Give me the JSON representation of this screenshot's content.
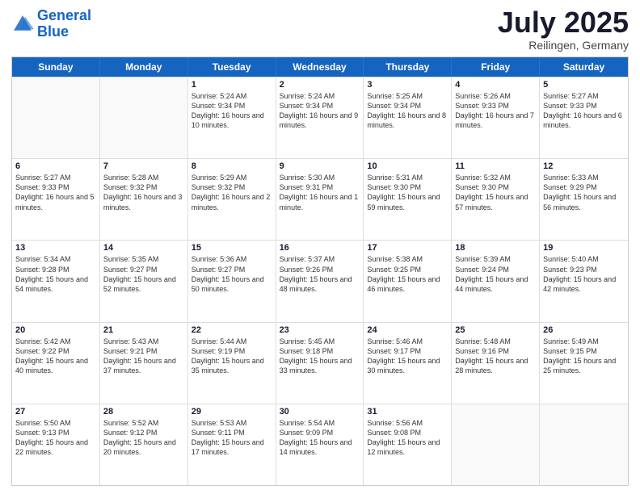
{
  "logo": {
    "line1": "General",
    "line2": "Blue"
  },
  "title": "July 2025",
  "location": "Reilingen, Germany",
  "weekdays": [
    "Sunday",
    "Monday",
    "Tuesday",
    "Wednesday",
    "Thursday",
    "Friday",
    "Saturday"
  ],
  "rows": [
    [
      {
        "day": "",
        "sunrise": "",
        "sunset": "",
        "daylight": ""
      },
      {
        "day": "",
        "sunrise": "",
        "sunset": "",
        "daylight": ""
      },
      {
        "day": "1",
        "sunrise": "Sunrise: 5:24 AM",
        "sunset": "Sunset: 9:34 PM",
        "daylight": "Daylight: 16 hours and 10 minutes."
      },
      {
        "day": "2",
        "sunrise": "Sunrise: 5:24 AM",
        "sunset": "Sunset: 9:34 PM",
        "daylight": "Daylight: 16 hours and 9 minutes."
      },
      {
        "day": "3",
        "sunrise": "Sunrise: 5:25 AM",
        "sunset": "Sunset: 9:34 PM",
        "daylight": "Daylight: 16 hours and 8 minutes."
      },
      {
        "day": "4",
        "sunrise": "Sunrise: 5:26 AM",
        "sunset": "Sunset: 9:33 PM",
        "daylight": "Daylight: 16 hours and 7 minutes."
      },
      {
        "day": "5",
        "sunrise": "Sunrise: 5:27 AM",
        "sunset": "Sunset: 9:33 PM",
        "daylight": "Daylight: 16 hours and 6 minutes."
      }
    ],
    [
      {
        "day": "6",
        "sunrise": "Sunrise: 5:27 AM",
        "sunset": "Sunset: 9:33 PM",
        "daylight": "Daylight: 16 hours and 5 minutes."
      },
      {
        "day": "7",
        "sunrise": "Sunrise: 5:28 AM",
        "sunset": "Sunset: 9:32 PM",
        "daylight": "Daylight: 16 hours and 3 minutes."
      },
      {
        "day": "8",
        "sunrise": "Sunrise: 5:29 AM",
        "sunset": "Sunset: 9:32 PM",
        "daylight": "Daylight: 16 hours and 2 minutes."
      },
      {
        "day": "9",
        "sunrise": "Sunrise: 5:30 AM",
        "sunset": "Sunset: 9:31 PM",
        "daylight": "Daylight: 16 hours and 1 minute."
      },
      {
        "day": "10",
        "sunrise": "Sunrise: 5:31 AM",
        "sunset": "Sunset: 9:30 PM",
        "daylight": "Daylight: 15 hours and 59 minutes."
      },
      {
        "day": "11",
        "sunrise": "Sunrise: 5:32 AM",
        "sunset": "Sunset: 9:30 PM",
        "daylight": "Daylight: 15 hours and 57 minutes."
      },
      {
        "day": "12",
        "sunrise": "Sunrise: 5:33 AM",
        "sunset": "Sunset: 9:29 PM",
        "daylight": "Daylight: 15 hours and 56 minutes."
      }
    ],
    [
      {
        "day": "13",
        "sunrise": "Sunrise: 5:34 AM",
        "sunset": "Sunset: 9:28 PM",
        "daylight": "Daylight: 15 hours and 54 minutes."
      },
      {
        "day": "14",
        "sunrise": "Sunrise: 5:35 AM",
        "sunset": "Sunset: 9:27 PM",
        "daylight": "Daylight: 15 hours and 52 minutes."
      },
      {
        "day": "15",
        "sunrise": "Sunrise: 5:36 AM",
        "sunset": "Sunset: 9:27 PM",
        "daylight": "Daylight: 15 hours and 50 minutes."
      },
      {
        "day": "16",
        "sunrise": "Sunrise: 5:37 AM",
        "sunset": "Sunset: 9:26 PM",
        "daylight": "Daylight: 15 hours and 48 minutes."
      },
      {
        "day": "17",
        "sunrise": "Sunrise: 5:38 AM",
        "sunset": "Sunset: 9:25 PM",
        "daylight": "Daylight: 15 hours and 46 minutes."
      },
      {
        "day": "18",
        "sunrise": "Sunrise: 5:39 AM",
        "sunset": "Sunset: 9:24 PM",
        "daylight": "Daylight: 15 hours and 44 minutes."
      },
      {
        "day": "19",
        "sunrise": "Sunrise: 5:40 AM",
        "sunset": "Sunset: 9:23 PM",
        "daylight": "Daylight: 15 hours and 42 minutes."
      }
    ],
    [
      {
        "day": "20",
        "sunrise": "Sunrise: 5:42 AM",
        "sunset": "Sunset: 9:22 PM",
        "daylight": "Daylight: 15 hours and 40 minutes."
      },
      {
        "day": "21",
        "sunrise": "Sunrise: 5:43 AM",
        "sunset": "Sunset: 9:21 PM",
        "daylight": "Daylight: 15 hours and 37 minutes."
      },
      {
        "day": "22",
        "sunrise": "Sunrise: 5:44 AM",
        "sunset": "Sunset: 9:19 PM",
        "daylight": "Daylight: 15 hours and 35 minutes."
      },
      {
        "day": "23",
        "sunrise": "Sunrise: 5:45 AM",
        "sunset": "Sunset: 9:18 PM",
        "daylight": "Daylight: 15 hours and 33 minutes."
      },
      {
        "day": "24",
        "sunrise": "Sunrise: 5:46 AM",
        "sunset": "Sunset: 9:17 PM",
        "daylight": "Daylight: 15 hours and 30 minutes."
      },
      {
        "day": "25",
        "sunrise": "Sunrise: 5:48 AM",
        "sunset": "Sunset: 9:16 PM",
        "daylight": "Daylight: 15 hours and 28 minutes."
      },
      {
        "day": "26",
        "sunrise": "Sunrise: 5:49 AM",
        "sunset": "Sunset: 9:15 PM",
        "daylight": "Daylight: 15 hours and 25 minutes."
      }
    ],
    [
      {
        "day": "27",
        "sunrise": "Sunrise: 5:50 AM",
        "sunset": "Sunset: 9:13 PM",
        "daylight": "Daylight: 15 hours and 22 minutes."
      },
      {
        "day": "28",
        "sunrise": "Sunrise: 5:52 AM",
        "sunset": "Sunset: 9:12 PM",
        "daylight": "Daylight: 15 hours and 20 minutes."
      },
      {
        "day": "29",
        "sunrise": "Sunrise: 5:53 AM",
        "sunset": "Sunset: 9:11 PM",
        "daylight": "Daylight: 15 hours and 17 minutes."
      },
      {
        "day": "30",
        "sunrise": "Sunrise: 5:54 AM",
        "sunset": "Sunset: 9:09 PM",
        "daylight": "Daylight: 15 hours and 14 minutes."
      },
      {
        "day": "31",
        "sunrise": "Sunrise: 5:56 AM",
        "sunset": "Sunset: 9:08 PM",
        "daylight": "Daylight: 15 hours and 12 minutes."
      },
      {
        "day": "",
        "sunrise": "",
        "sunset": "",
        "daylight": ""
      },
      {
        "day": "",
        "sunrise": "",
        "sunset": "",
        "daylight": ""
      }
    ]
  ]
}
